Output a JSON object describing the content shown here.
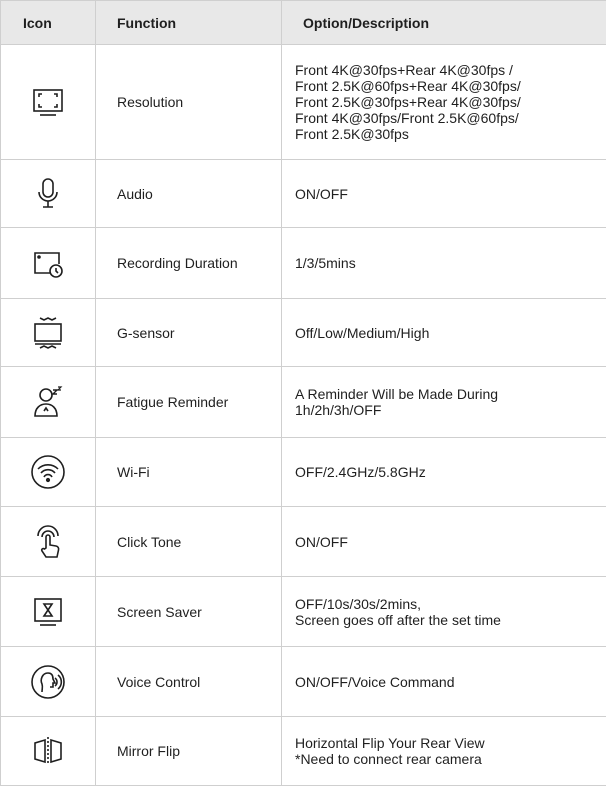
{
  "headers": {
    "icon": "Icon",
    "function": "Function",
    "option": "Option/Description"
  },
  "rows": [
    {
      "icon": "resolution-icon",
      "function": "Resolution",
      "lines": [
        "Front 4K@30fps+Rear 4K@30fps /",
        "Front 2.5K@60fps+Rear 4K@30fps/",
        "Front 2.5K@30fps+Rear 4K@30fps/",
        "Front 4K@30fps/Front 2.5K@60fps/",
        "Front 2.5K@30fps"
      ]
    },
    {
      "icon": "microphone-icon",
      "function": "Audio",
      "lines": [
        "ON/OFF"
      ]
    },
    {
      "icon": "recording-timer-icon",
      "function": "Recording Duration",
      "lines": [
        "1/3/5mins"
      ]
    },
    {
      "icon": "g-sensor-icon",
      "function": "G-sensor",
      "lines": [
        "Off/Low/Medium/High"
      ]
    },
    {
      "icon": "fatigue-icon",
      "function": "Fatigue Reminder",
      "lines": [
        "A Reminder Will be Made During",
        "1h/2h/3h/OFF"
      ]
    },
    {
      "icon": "wifi-icon",
      "function": "Wi-Fi",
      "lines": [
        "OFF/2.4GHz/5.8GHz"
      ]
    },
    {
      "icon": "touch-tone-icon",
      "function": "Click Tone",
      "lines": [
        "ON/OFF"
      ]
    },
    {
      "icon": "hourglass-screen-icon",
      "function": "Screen Saver",
      "lines": [
        "OFF/10s/30s/2mins,",
        "Screen goes off after the set time"
      ]
    },
    {
      "icon": "voice-control-icon",
      "function": "Voice Control",
      "lines": [
        "ON/OFF/Voice Command"
      ]
    },
    {
      "icon": "mirror-flip-icon",
      "function": "Mirror Flip",
      "lines": [
        "Horizontal Flip Your Rear View",
        "*Need to connect rear camera"
      ]
    }
  ]
}
